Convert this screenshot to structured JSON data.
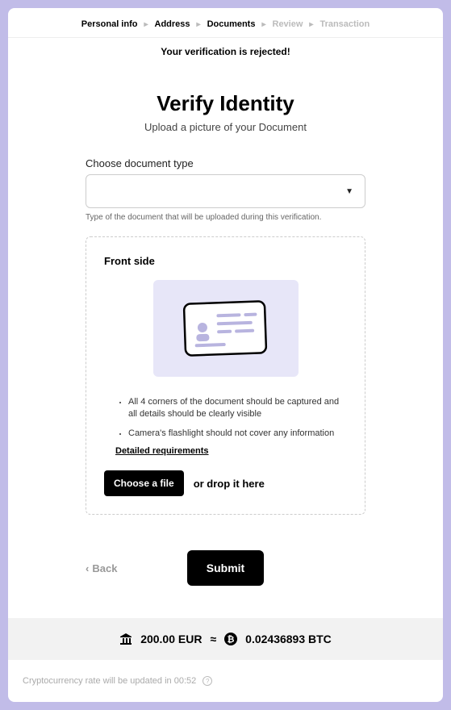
{
  "breadcrumb": {
    "steps": [
      {
        "label": "Personal info",
        "active": true
      },
      {
        "label": "Address",
        "active": true
      },
      {
        "label": "Documents",
        "active": true
      },
      {
        "label": "Review",
        "active": false
      },
      {
        "label": "Transaction",
        "active": false
      }
    ]
  },
  "status": {
    "text": "Your verification is rejected!"
  },
  "header": {
    "title": "Verify Identity",
    "subtitle": "Upload a picture of your Document"
  },
  "doc_type": {
    "label": "Choose document type",
    "selected": "",
    "helper": "Type of the document that will be uploaded during this verification."
  },
  "upload": {
    "title": "Front side",
    "requirements": [
      "All 4 corners of the document should be captured and all details should be clearly visible",
      "Camera's flashlight should not cover any information"
    ],
    "detailed_link": "Detailed requirements",
    "choose_label": "Choose a file",
    "drop_label": "or drop it here"
  },
  "actions": {
    "back": "Back",
    "submit": "Submit"
  },
  "rate": {
    "fiat": "200.00 EUR",
    "approx": "≈",
    "crypto": "0.02436893 BTC"
  },
  "footer": {
    "text": "Cryptocurrency rate will be updated in 00:52"
  }
}
